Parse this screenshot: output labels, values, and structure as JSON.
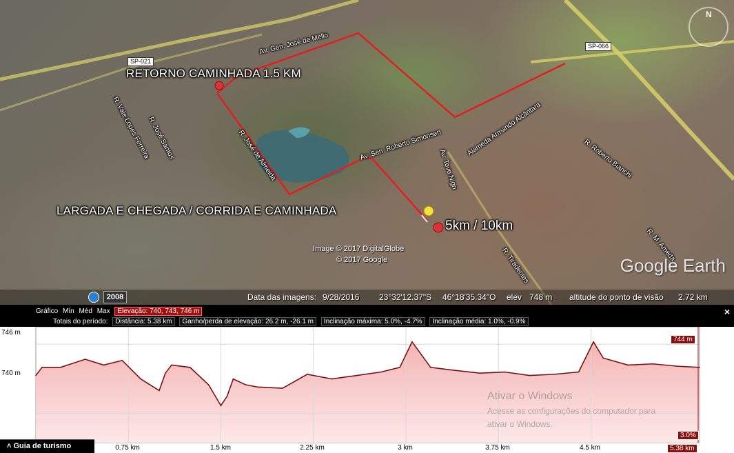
{
  "map": {
    "labels": {
      "return_walk": "RETORNO CAMINHADA 1.5 KM",
      "start_finish": "LARGADA E CHEGADA / CORRIDA E CAMINHADA",
      "distances": "5km / 10km"
    },
    "roads": {
      "sp021": "SP-021",
      "sp066": "SP-066"
    },
    "streets": [
      "Av. Gen. José de Mello",
      "Av. Sen. Roberto Simonsen",
      "R. José de Almeida",
      "Av. Teve Nigri",
      "Alameda Armando Alcântara",
      "R. Roberto Bianchi",
      "R. Tiradentes",
      "R. José Santos",
      "R. Vale Lopes Ferreira",
      "R. M. Ameda"
    ],
    "copyright_line1": "Image © 2017 DigitalGlobe",
    "copyright_line2": "© 2017 Google",
    "logo": "Google Earth",
    "compass_n": "N"
  },
  "statusbar": {
    "history_year": "2008",
    "image_date_label": "Data das imagens:",
    "image_date": "9/28/2016",
    "lat": "23°32'12.37\"S",
    "lon": "46°18'35.34\"O",
    "elev_label": "elev",
    "elev_value": "748 m",
    "eye_alt_label": "altitude do ponto de visão",
    "eye_alt_value": "2.72 km"
  },
  "elevation_profile": {
    "header": {
      "graph_label": "Gráfico",
      "min": "Mín",
      "avg": "Méd",
      "max": "Max",
      "elevation_box": "Elevação: 740, 743, 746 m",
      "totals_label": "Totais do período:",
      "distance_box": "Distância: 5.38 km",
      "gain_box": "Ganho/perda de elevação: 26.2 m, -26.1 m",
      "max_slope_box": "Inclinação máxima: 5.0%, -4.7%",
      "avg_slope_box": "Inclinação média: 1.0%, -0.9%"
    },
    "close_label": "×",
    "y_labels": [
      "746 m",
      "740 m"
    ],
    "x_labels": [
      "0.75 km",
      "1.5 km",
      "2.25 km",
      "3 km",
      "3.75 km",
      "4.5 km",
      "5.38 km"
    ],
    "current_value": "744 m",
    "current_slope": "3.0%",
    "tour_button": "Guia de turismo",
    "watermark_title": "Ativar o Windows",
    "watermark_line1": "Acesse as configurações do computador para",
    "watermark_line2": "ativar o Windows.",
    "colors": {
      "line": "#7a1010",
      "fill_top": "#f4b4b4",
      "fill_bottom": "#fde8e8",
      "header_bg": "#000000",
      "highlight": "#a01010"
    }
  },
  "chart_data": {
    "type": "area",
    "xlabel": "",
    "ylabel": "",
    "xlim": [
      0,
      5.38
    ],
    "ylim": [
      737.5,
      747.5
    ],
    "x": [
      0,
      0.05,
      0.2,
      0.4,
      0.55,
      0.7,
      0.85,
      1.0,
      1.05,
      1.1,
      1.25,
      1.4,
      1.5,
      1.55,
      1.6,
      1.7,
      1.8,
      2.0,
      2.2,
      2.4,
      2.6,
      2.8,
      2.95,
      3.05,
      3.2,
      3.35,
      3.6,
      3.8,
      4.0,
      4.2,
      4.4,
      4.52,
      4.6,
      4.8,
      5.0,
      5.2,
      5.38
    ],
    "y": [
      743.3,
      744,
      744,
      744.7,
      744.2,
      744.6,
      743,
      742,
      743.5,
      744.2,
      744,
      742.5,
      740.7,
      741.5,
      743,
      742.5,
      742.3,
      742.2,
      743.4,
      743,
      743.3,
      743.6,
      744,
      746.2,
      744,
      743.8,
      743.5,
      743.6,
      743.3,
      743.4,
      743.6,
      746.2,
      744.8,
      744.2,
      744.3,
      744.1,
      744.0
    ],
    "series": [
      {
        "name": "",
        "values": []
      }
    ]
  }
}
